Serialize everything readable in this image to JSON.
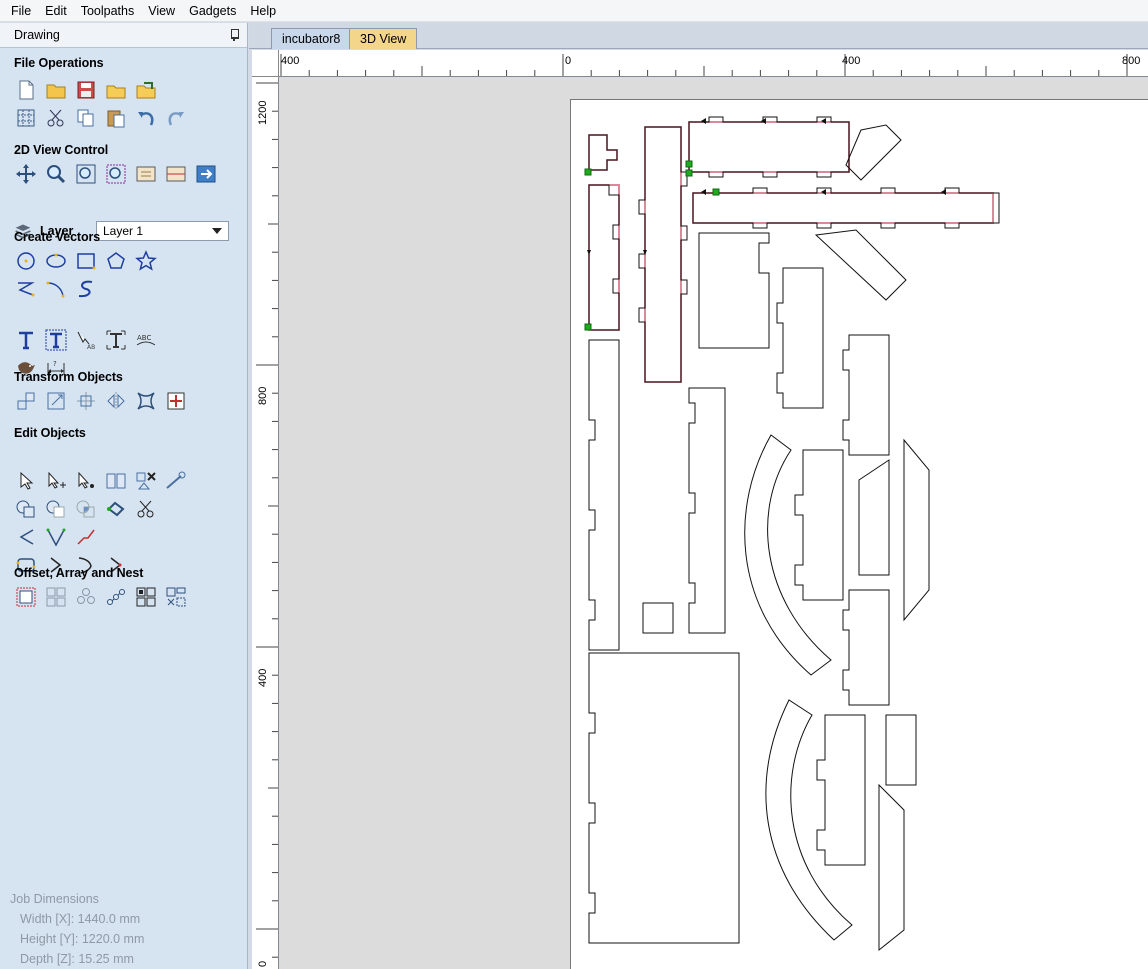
{
  "menubar": {
    "items": [
      "File",
      "Edit",
      "Toolpaths",
      "View",
      "Gadgets",
      "Help"
    ]
  },
  "panel": {
    "title": "Drawing",
    "sections": {
      "file_operations": "File Operations",
      "view_control": "2D View Control",
      "create_vectors": "Create Vectors",
      "transform_objects": "Transform Objects",
      "edit_objects": "Edit Objects",
      "offset_array_nest": "Offset, Array and Nest"
    },
    "layer": {
      "label": "Layer",
      "selected": "Layer 1"
    }
  },
  "job_dimensions": {
    "title": "Job Dimensions",
    "width": "Width  [X]: 1440.0 mm",
    "height": "Height [Y]: 1220.0 mm",
    "depth": "Depth  [Z]: 15.25 mm"
  },
  "tabs": [
    {
      "label": "incubator8",
      "active": true
    },
    {
      "label": "3D View",
      "active": false
    }
  ],
  "ruler": {
    "top_labels": [
      "400",
      "0",
      "400",
      "800"
    ],
    "left_labels": [
      "1200",
      "800",
      "400",
      "0"
    ]
  },
  "colors": {
    "panel_bg": "#d6e4f2",
    "canvas_bg": "#dcdcdc",
    "tab_3d": "#f4d68a",
    "selection_handle": "#1faa1f",
    "toolpath_pink": "#d98a9a"
  }
}
